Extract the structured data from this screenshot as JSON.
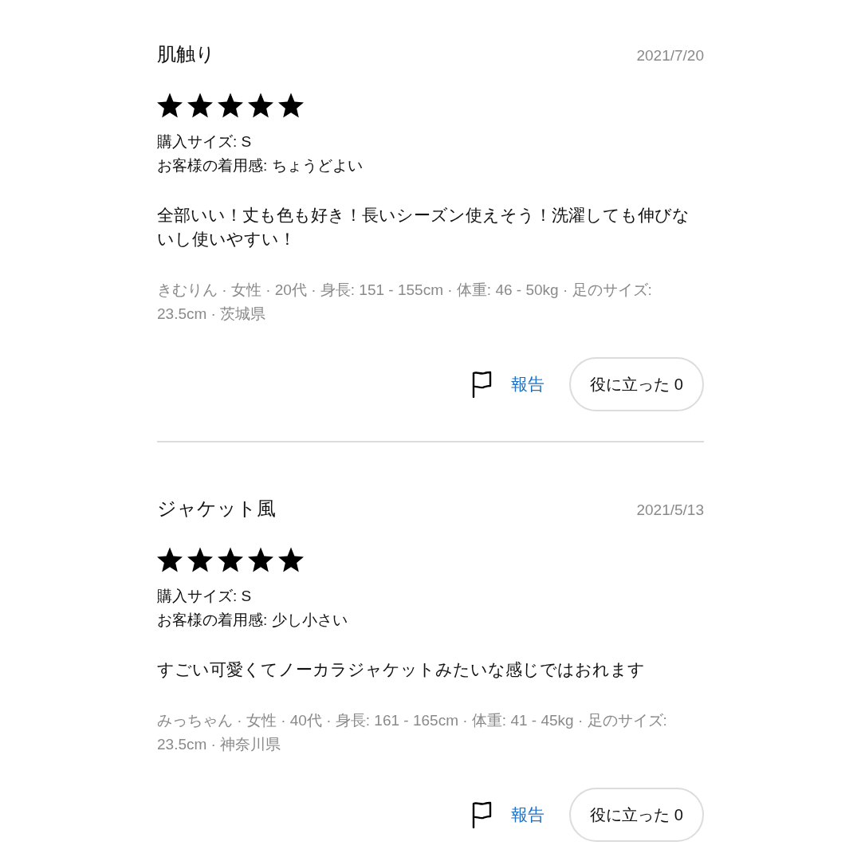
{
  "reviews": [
    {
      "title": "肌触り",
      "date": "2021/7/20",
      "stars": 5,
      "purchase_size": "購入サイズ: S",
      "fit": "お客様の着用感: ちょうどよい",
      "body": "全部いい！丈も色も好き！長いシーズン使えそう！洗濯しても伸びないし使いやすい！",
      "reviewer": "きむりん · 女性 · 20代 · 身長: 151 - 155cm · 体重: 46 - 50kg · 足のサイズ: 23.5cm · 茨城県",
      "report_label": "報告",
      "helpful_label": "役に立った 0"
    },
    {
      "title": "ジャケット風",
      "date": "2021/5/13",
      "stars": 5,
      "purchase_size": "購入サイズ: S",
      "fit": "お客様の着用感: 少し小さい",
      "body": "すごい可愛くてノーカラジャケットみたいな感じではおれます",
      "reviewer": "みっちゃん · 女性 · 40代 · 身長: 161 - 165cm · 体重: 41 - 45kg · 足のサイズ: 23.5cm · 神奈川県",
      "report_label": "報告",
      "helpful_label": "役に立った 0"
    }
  ]
}
